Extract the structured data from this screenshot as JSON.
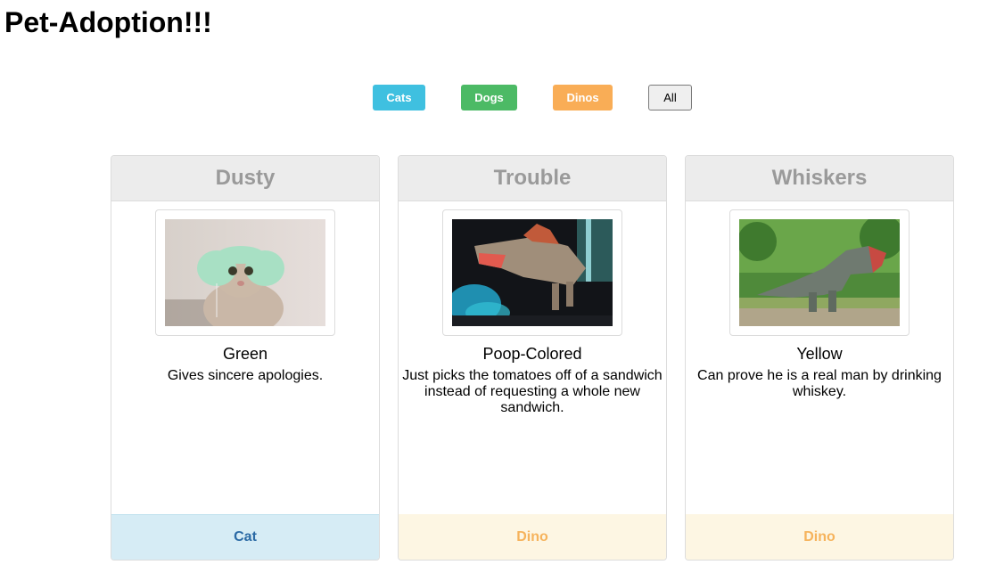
{
  "page": {
    "title": "Pet-Adoption!!!"
  },
  "filters": [
    {
      "label": "Cats",
      "color": "#3fc0e0"
    },
    {
      "label": "Dogs",
      "color": "#4cba65"
    },
    {
      "label": "Dinos",
      "color": "#f9ad56"
    },
    {
      "label": "All",
      "color": "#efefef"
    }
  ],
  "pets": [
    {
      "name": "Dusty",
      "color": "Green",
      "description": "Gives sincere apologies.",
      "type": "Cat",
      "image": "cat-with-knit-hair-buns-photo"
    },
    {
      "name": "Trouble",
      "color": "Poop-Colored",
      "description": "Just picks the tomatoes off of a sandwich instead of requesting a whole new sandwich.",
      "type": "Dino",
      "image": "spinosaurus-model-photo"
    },
    {
      "name": "Whiskers",
      "color": "Yellow",
      "description": "Can prove he is a real man by drinking whiskey.",
      "type": "Dino",
      "image": "t-rex-statue-in-forest-photo"
    }
  ]
}
